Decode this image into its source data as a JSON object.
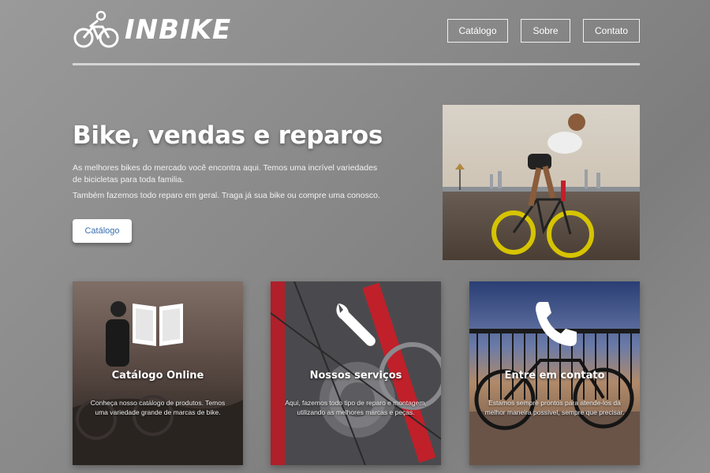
{
  "header": {
    "logo_text": "INBIKE",
    "nav": [
      {
        "label": "Catálogo"
      },
      {
        "label": "Sobre"
      },
      {
        "label": "Contato"
      }
    ]
  },
  "hero": {
    "title": "Bike, vendas e reparos",
    "paragraph1": "As melhores bikes do mercado você encontra aqui. Temos uma incrível variedades de bicicletas para toda familia.",
    "paragraph2": "Também fazemos todo reparo em geral. Traga já sua bike ou compre uma conosco.",
    "button_label": "Catálogo"
  },
  "cards": [
    {
      "title": "Catálogo Online",
      "text": "Conheça nosso catálogo de produtos. Temos uma variedade grande de marcas de bike.",
      "icon": "book-icon"
    },
    {
      "title": "Nossos serviços",
      "text": "Aqui, fazemos todo tipo de reparo e montagem, utilizando as melhores marcas e peças.",
      "icon": "wrench-icon"
    },
    {
      "title": "Entre em contato",
      "text": "Estamos sempre prontos para atende-los da melhor maneira possível, sempre que precisar.",
      "icon": "phone-icon"
    }
  ],
  "colors": {
    "button_text": "#3a6fb0",
    "background": "#8a8a8a"
  }
}
